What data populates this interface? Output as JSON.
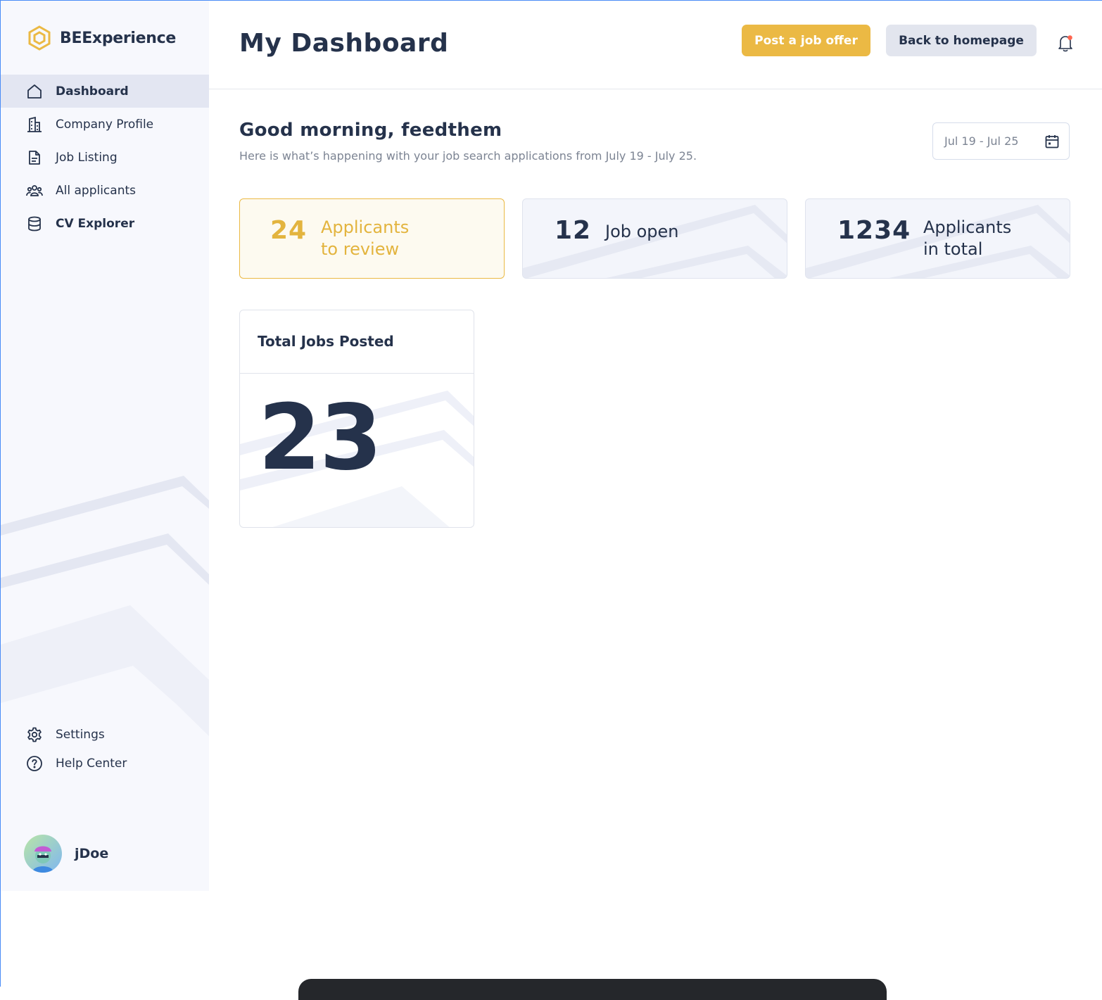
{
  "brand": {
    "name": "BEExperience",
    "icon": "hexagon-logo-icon",
    "color": "#EBB944"
  },
  "sidebar": {
    "items": [
      {
        "label": "Dashboard",
        "icon": "home-icon",
        "active": true
      },
      {
        "label": "Company Profile",
        "icon": "building-icon",
        "active": false
      },
      {
        "label": "Job Listing",
        "icon": "document-icon",
        "active": false
      },
      {
        "label": "All applicants",
        "icon": "users-icon",
        "active": false
      },
      {
        "label": "CV Explorer",
        "icon": "database-icon",
        "active": false
      }
    ],
    "bottom_items": [
      {
        "label": "Settings",
        "icon": "gear-icon"
      },
      {
        "label": "Help Center",
        "icon": "help-circle-icon"
      }
    ]
  },
  "user": {
    "name": "jDoe",
    "avatar": "avatar-icon"
  },
  "header": {
    "title": "My Dashboard",
    "post_job_label": "Post a job offer",
    "back_home_label": "Back to homepage",
    "notification_icon": "bell-icon",
    "has_unread": true
  },
  "greeting": {
    "title": "Good morning, feedthem",
    "subtitle": "Here is what’s happening with your job search applications from July 19 - July 25."
  },
  "date_range": {
    "label": "Jul 19 - Jul 25",
    "icon": "calendar-icon"
  },
  "stats": [
    {
      "value": "24",
      "label_line1": "Applicants",
      "label_line2": "to review",
      "highlight": true
    },
    {
      "value": "12",
      "label_line1": "Job open",
      "label_line2": "",
      "highlight": false
    },
    {
      "value": "1234",
      "label_line1": "Applicants",
      "label_line2": "in total",
      "highlight": false
    }
  ],
  "total_jobs": {
    "title": "Total Jobs Posted",
    "value": "23"
  },
  "colors": {
    "accent": "#EBB944",
    "text": "#25324B",
    "muted": "#7C8493",
    "sidebar_bg": "#F7F8FD",
    "active_bg": "#E3E6F2",
    "alert": "#FF6550"
  }
}
